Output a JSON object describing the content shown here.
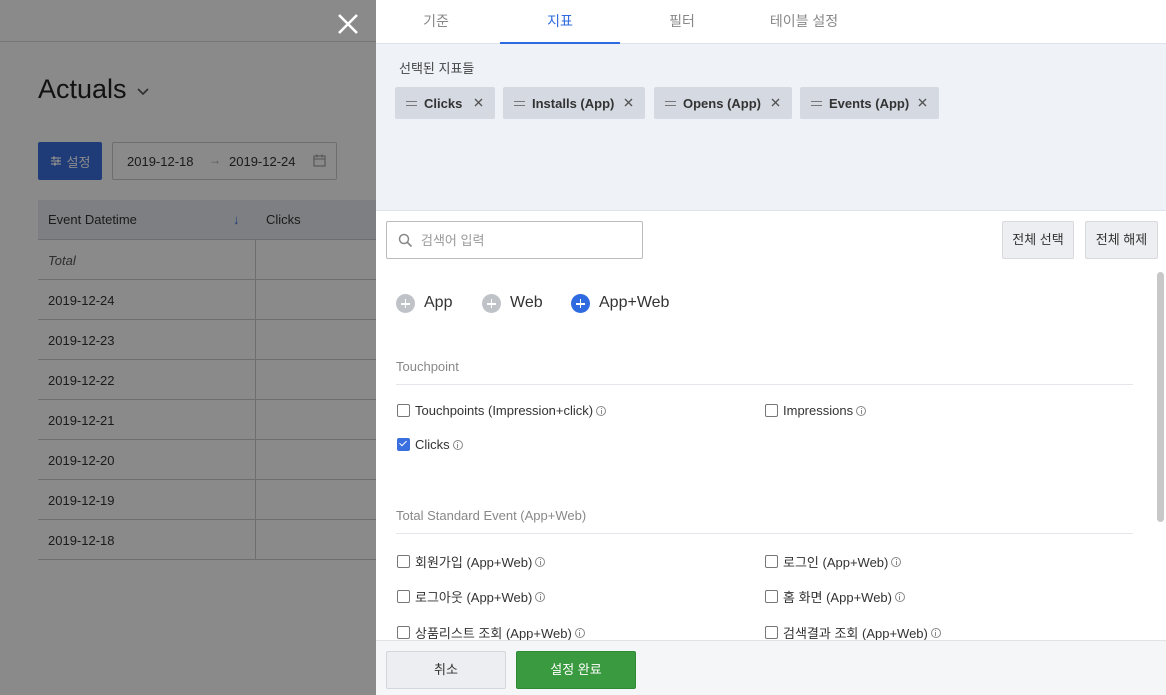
{
  "background": {
    "page_title": "Actuals",
    "settings_button": "설정",
    "date_start": "2019-12-18",
    "date_end": "2019-12-24",
    "table_headers": [
      "Event Datetime",
      "Clicks"
    ],
    "total_label": "Total",
    "rows": [
      "2019-12-24",
      "2019-12-23",
      "2019-12-22",
      "2019-12-21",
      "2019-12-20",
      "2019-12-19",
      "2019-12-18"
    ]
  },
  "drawer": {
    "tabs": [
      "기준",
      "지표",
      "필터",
      "테이블 설정"
    ],
    "active_tab": "지표",
    "selected_title": "선택된 지표들",
    "chips": [
      "Clicks",
      "Installs (App)",
      "Opens (App)",
      "Events (App)"
    ],
    "search_placeholder": "검색어 입력",
    "select_all": "전체 선택",
    "deselect_all": "전체 해제",
    "platforms": [
      {
        "label": "App",
        "active": false
      },
      {
        "label": "Web",
        "active": false
      },
      {
        "label": "App+Web",
        "active": true
      }
    ],
    "sections": [
      {
        "title": "Touchpoint",
        "items": [
          {
            "label": "Touchpoints (Impression+click)",
            "checked": false
          },
          {
            "label": "Impressions",
            "checked": false
          },
          {
            "label": "Clicks",
            "checked": true
          }
        ]
      },
      {
        "title": "Total Standard Event (App+Web)",
        "items": [
          {
            "label": "회원가입 (App+Web)",
            "checked": false
          },
          {
            "label": "로그인 (App+Web)",
            "checked": false
          },
          {
            "label": "로그아웃 (App+Web)",
            "checked": false
          },
          {
            "label": "홈 화면 (App+Web)",
            "checked": false
          },
          {
            "label": "상품리스트 조회 (App+Web)",
            "checked": false
          },
          {
            "label": "검색결과 조회 (App+Web)",
            "checked": false
          }
        ]
      }
    ],
    "cancel": "취소",
    "confirm": "설정 완료"
  },
  "colors": {
    "accent": "#2f6be0",
    "confirm_green": "#3a9a3f",
    "overlay": "rgba(0,0,0,0.46)"
  }
}
